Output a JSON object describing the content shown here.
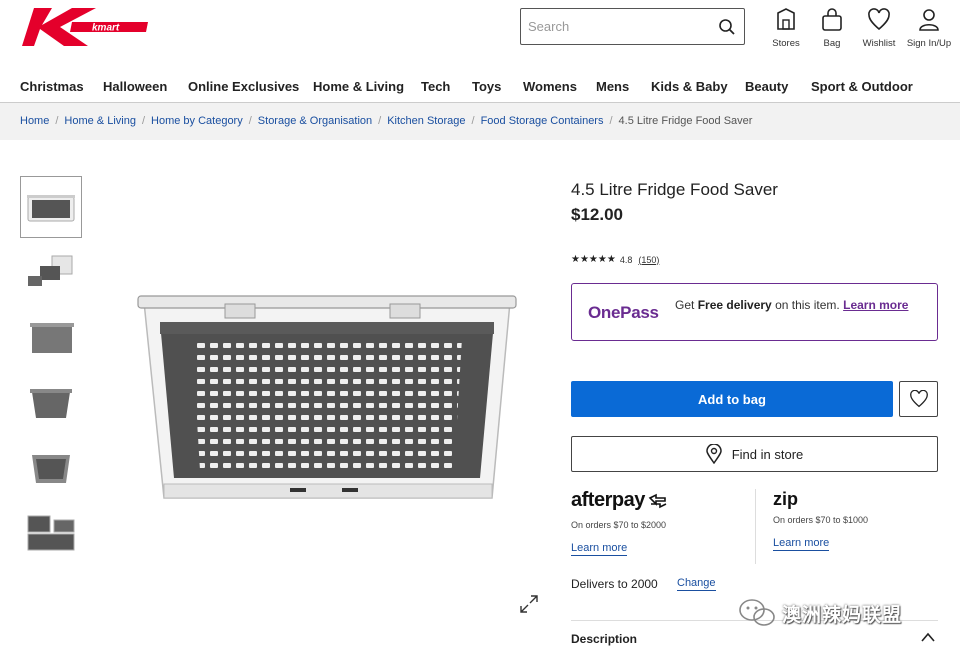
{
  "brand": {
    "logo_text": "kmart",
    "color": "#e4002b"
  },
  "search": {
    "placeholder": "Search"
  },
  "header_icons": [
    {
      "label": "Stores",
      "icon": "store-icon"
    },
    {
      "label": "Bag",
      "icon": "bag-icon"
    },
    {
      "label": "Wishlist",
      "icon": "heart-icon"
    },
    {
      "label": "Sign In/Up",
      "icon": "user-icon"
    }
  ],
  "nav": [
    "Christmas",
    "Halloween",
    "Online Exclusives",
    "Home & Living",
    "Tech",
    "Toys",
    "Womens",
    "Mens",
    "Kids & Baby",
    "Beauty",
    "Sport & Outdoor"
  ],
  "breadcrumb": [
    "Home",
    "Home & Living",
    "Home by Category",
    "Storage & Organisation",
    "Kitchen Storage",
    "Food Storage Containers",
    "4.5 Litre Fridge Food Saver"
  ],
  "product": {
    "title": "4.5 Litre Fridge Food Saver",
    "price": "$12.00",
    "stars": "★★★★★",
    "rating": "4.8",
    "review_count": "(150)"
  },
  "onepass": {
    "logo": "OnePass",
    "text_pre": "Get ",
    "text_bold": "Free delivery",
    "text_post": " on this item. ",
    "link": "Learn more",
    "color": "#6a2c91"
  },
  "buttons": {
    "add_to_bag": "Add to bag",
    "find_in_store": "Find in store",
    "add_color": "#0a6ad6"
  },
  "afterpay": {
    "logo": "afterpay",
    "sub": "On orders $70 to $2000",
    "link": "Learn more"
  },
  "zip": {
    "logo": "zip",
    "sub": "On orders $70 to $1000",
    "link": "Learn more"
  },
  "delivery": {
    "text": "Delivers to 2000",
    "change": "Change"
  },
  "description": {
    "label": "Description"
  },
  "watermark": {
    "text": "澳洲辣妈联盟"
  }
}
